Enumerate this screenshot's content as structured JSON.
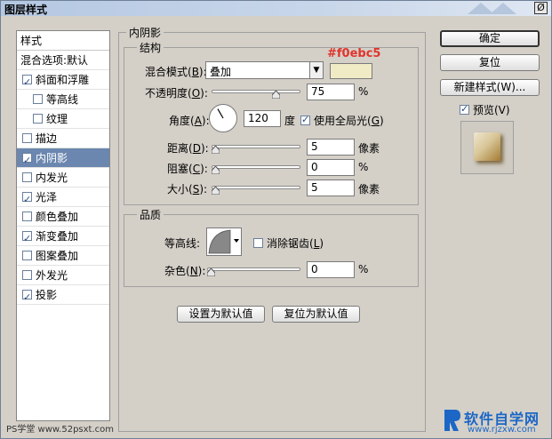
{
  "window": {
    "title": "图层样式",
    "close_glyph": "Ø"
  },
  "stylelist": {
    "header": "样式",
    "blend_default": "混合选项:默认",
    "items": [
      {
        "label": "斜面和浮雕",
        "checked": true
      },
      {
        "label": "等高线",
        "checked": false,
        "sub": true
      },
      {
        "label": "纹理",
        "checked": false,
        "sub": true
      },
      {
        "label": "描边",
        "checked": false
      },
      {
        "label": "内阴影",
        "checked": true,
        "selected": true
      },
      {
        "label": "内发光",
        "checked": false
      },
      {
        "label": "光泽",
        "checked": true
      },
      {
        "label": "颜色叠加",
        "checked": false
      },
      {
        "label": "渐变叠加",
        "checked": true
      },
      {
        "label": "图案叠加",
        "checked": false
      },
      {
        "label": "外发光",
        "checked": false
      },
      {
        "label": "投影",
        "checked": true
      }
    ]
  },
  "panel": {
    "title": "内阴影",
    "structure": {
      "legend": "结构",
      "blend_mode_label": "混合模式(",
      "blend_mode_key": "B",
      "blend_mode_value": "叠加",
      "color_hex": "#f0ebc5",
      "opacity_label": "不透明度(",
      "opacity_key": "O",
      "opacity_value": "75",
      "opacity_fraction": 0.75,
      "percent": "%",
      "angle_label": "角度(",
      "angle_key": "A",
      "angle_value": "120",
      "angle_unit": "度",
      "global_light_label": "使用全局光(",
      "global_light_key": "G",
      "global_light_checked": true,
      "distance_label": "距离(",
      "distance_key": "D",
      "distance_value": "5",
      "px_unit": "像素",
      "choke_label": "阻塞(",
      "choke_key": "C",
      "choke_value": "0",
      "size_label": "大小(",
      "size_key": "S",
      "size_value": "5"
    },
    "quality": {
      "legend": "品质",
      "contour_label": "等高线:",
      "antialias_label": "消除锯齿(",
      "antialias_key": "L",
      "antialias_checked": false,
      "noise_label": "杂色(",
      "noise_key": "N",
      "noise_value": "0"
    },
    "buttons": {
      "set_default": "设置为默认值",
      "reset_default": "复位为默认值"
    }
  },
  "right": {
    "ok": "确定",
    "reset": "复位",
    "new_style": "新建样式(W)...",
    "preview_label": "预览(V)",
    "preview_checked": true
  },
  "watermark": {
    "left": "PS学堂 www.52psxt.com",
    "right_big": "软件自学网",
    "right_small": "www.rjzxw.com"
  }
}
